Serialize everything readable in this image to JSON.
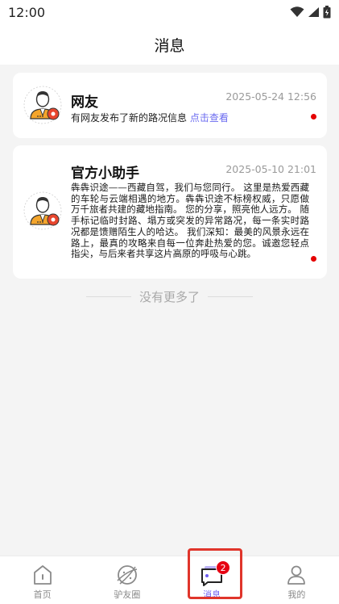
{
  "status_bar": {
    "time": "12:00",
    "icons": [
      "wifi-icon",
      "signal-icon",
      "battery-icon"
    ]
  },
  "header": {
    "title": "消息"
  },
  "messages": [
    {
      "name": "网友",
      "time": "2025-05-24 12:56",
      "text": "有网友发布了新的路况信息",
      "link": "点击查看",
      "unread": true,
      "avatar_icon": "user-gear-avatar-icon"
    },
    {
      "name": "官方小助手",
      "time": "2025-05-10 21:01",
      "text": "犇犇识途——西藏自驾，我们与您同行。 这里是热爱西藏的车轮与云端相遇的地方。犇犇识途不标榜权威，只愿做万千旅者共建的藏地指南。 您的分享，照亮他人远方。 随手标记临时封路、塌方或突发的异常路况，每一条实时路况都是馈赠陌生人的哈达。 我们深知：最美的风景永远在路上，最真的攻略来自每一位奔赴热爱的您。诚邀您轻点指尖，与后来者共享这片高原的呼吸与心跳。",
      "unread": true,
      "avatar_icon": "user-gear-avatar-icon"
    }
  ],
  "list_end_text": "没有更多了",
  "tab_bar": {
    "tabs": [
      {
        "label": "首页",
        "icon": "home-icon",
        "active": false
      },
      {
        "label": "驴友圈",
        "icon": "planet-icon",
        "active": false
      },
      {
        "label": "消息",
        "icon": "message-icon",
        "active": true,
        "badge": "2"
      },
      {
        "label": "我的",
        "icon": "profile-icon",
        "active": false
      }
    ]
  },
  "colors": {
    "accent": "#6e5cf0",
    "badge": "#e60012",
    "unread_dot": "#e50000",
    "highlight_border": "#e0352b",
    "avatar_orange": "#f4a52c"
  }
}
